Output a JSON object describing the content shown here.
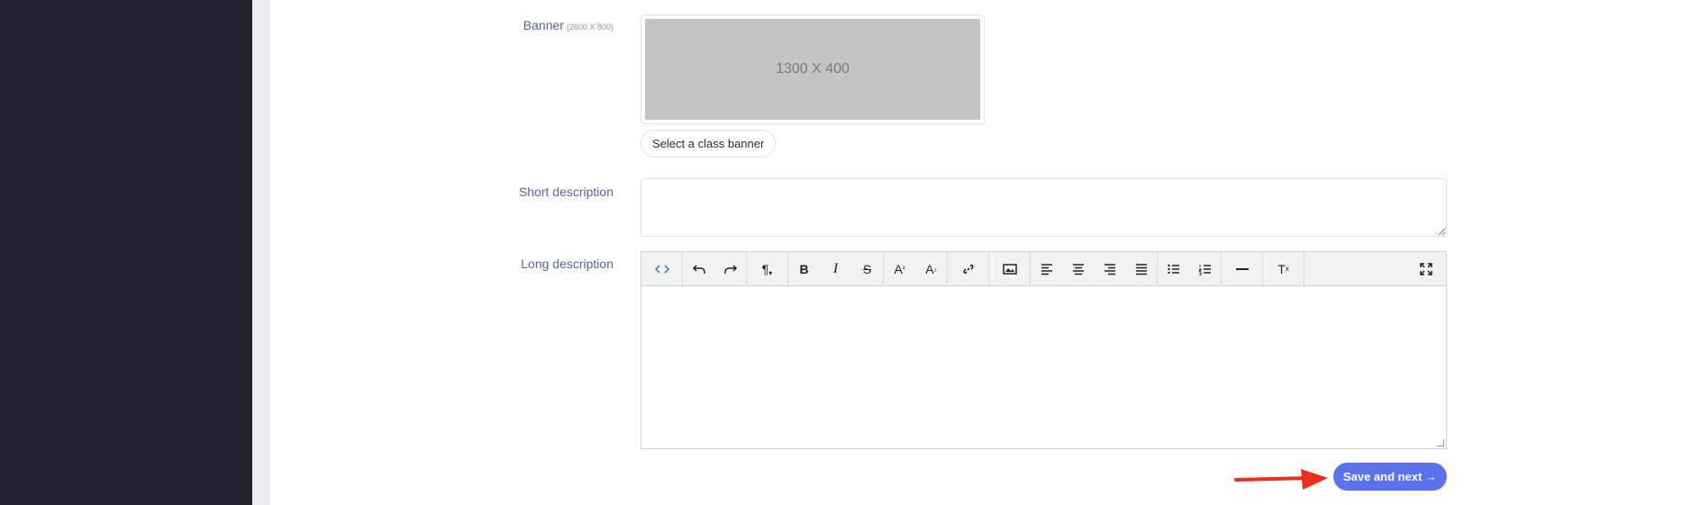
{
  "form": {
    "banner_label": "Banner",
    "banner_size_hint": "(2600 X 800)",
    "banner_placeholder": "1300 X 400",
    "select_banner_button": "Select a class banner",
    "short_description_label": "Short description",
    "short_description_value": "",
    "long_description_label": "Long description",
    "long_description_value": "",
    "save_button": "Save and next →"
  },
  "toolbar": {
    "tools": [
      "code-view",
      "undo",
      "redo",
      "paragraph",
      "bold",
      "italic",
      "strikethrough",
      "superscript",
      "subscript",
      "link",
      "image",
      "align-left",
      "align-center",
      "align-right",
      "justify",
      "unordered-list",
      "ordered-list",
      "horizontal-rule",
      "clear-formatting",
      "fullscreen"
    ]
  },
  "colors": {
    "sidebar": "#1e202d",
    "label": "#5563a6",
    "primary_button": "#5b72ee",
    "annotation_arrow": "#e8301c"
  }
}
